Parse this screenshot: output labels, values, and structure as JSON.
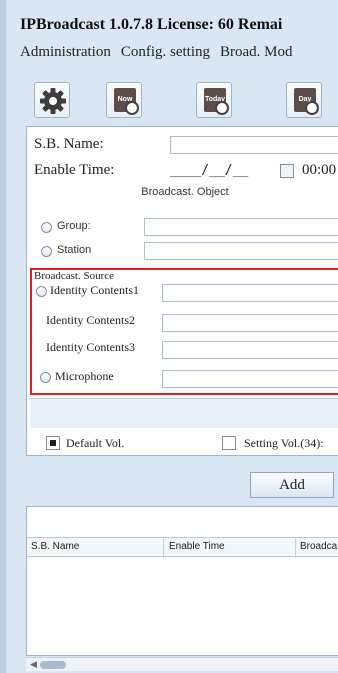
{
  "window": {
    "title": "IPBroadcast 1.0.7.8 License: 60 Remai"
  },
  "menu": {
    "items": [
      "Administration",
      "Config. setting",
      "Broad. Mod"
    ]
  },
  "toolbar": {
    "gear_icon": "gear-icon",
    "now_label": "Now",
    "today_label": "Today",
    "day_label": "Day"
  },
  "form": {
    "sb_name_label": "S.B. Name:",
    "sb_name_value": "",
    "enable_time_label": "Enable Time:",
    "enable_date_value": "____/__/__",
    "enable_time_value": "00:00"
  },
  "broadcast_object": {
    "title": "Broadcast. Object",
    "group_label": "Group:",
    "station_label": "Station"
  },
  "broadcast_source": {
    "title": "Broadcast. Source",
    "identity1_label": "Identity Contents1",
    "identity2_label": "Identity Contents2",
    "identity3_label": "Identity Contents3",
    "microphone_label": "Microphone"
  },
  "volume": {
    "default_label": "Default Vol.",
    "default_checked": true,
    "setting_label": "Setting Vol.(34):",
    "setting_checked": false
  },
  "actions": {
    "add_label": "Add"
  },
  "list": {
    "columns": [
      "S.B. Name",
      "Enable Time",
      "Broadca"
    ]
  },
  "colors": {
    "highlight_border": "#e02020",
    "window_bg": "#d9e7f5"
  }
}
